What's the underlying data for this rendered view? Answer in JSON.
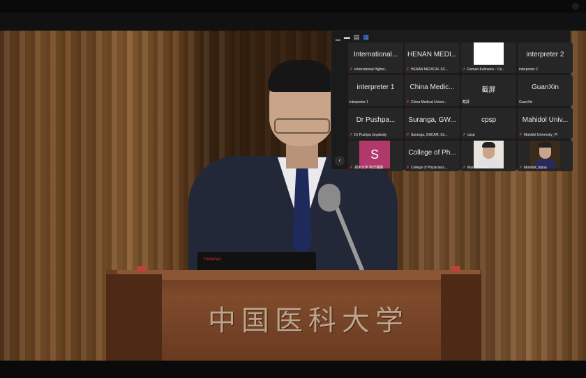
{
  "podium": {
    "inscription": "中国医科大学",
    "laptop_brand": "ThinkPad"
  },
  "view_controls": [
    {
      "icon": "minimize-icon",
      "glyph": "▁"
    },
    {
      "icon": "speaker-view-icon",
      "glyph": "▬"
    },
    {
      "icon": "strip-view-icon",
      "glyph": "▤"
    },
    {
      "icon": "gallery-view-icon",
      "glyph": "▦"
    }
  ],
  "collapse_glyph": "‹",
  "participants": [
    {
      "name": "International...",
      "label": "International Higher..."
    },
    {
      "name": "HENAN MEDI...",
      "label": "HENAN MEDICAL SC..."
    },
    {
      "name": "",
      "label": "Roman Kalmatov - Os..."
    },
    {
      "name": "interpreter 2",
      "label": "interpreter 2"
    },
    {
      "name": "interpreter 1",
      "label": "interpreter 1"
    },
    {
      "name": "China Medic...",
      "label": "China Medical Univer..."
    },
    {
      "name": "截屏",
      "label": "截屏"
    },
    {
      "name": "GuanXin",
      "label": "GuanXin"
    },
    {
      "name": "Dr  Pushpa...",
      "label": "Dr  Pushpa  Jayakody"
    },
    {
      "name": "Suranga, GW...",
      "label": "Suranga, GWUIM, Sri..."
    },
    {
      "name": "cpsp",
      "label": "cpsp"
    },
    {
      "name": "Mahidol Univ...",
      "label": "Mahidol University_PI"
    },
    {
      "name": "S",
      "label": "郑州大学 阿洋路鹏"
    },
    {
      "name": "College of Ph...",
      "label": "College of Physicians..."
    },
    {
      "name": "",
      "label": "Marut Chantra"
    },
    {
      "name": "",
      "label": "Mahidol_tripop"
    }
  ]
}
